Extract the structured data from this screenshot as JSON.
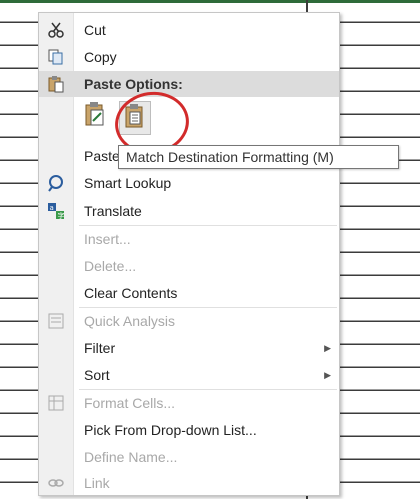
{
  "menu": {
    "items": [
      {
        "label": "Cut",
        "icon": "scissors-icon"
      },
      {
        "label": "Copy",
        "icon": "copy-icon"
      },
      {
        "label": "Paste Options:",
        "icon": "paste-icon"
      },
      {
        "label": "Paste Special...",
        "icon": ""
      },
      {
        "label": "Smart Lookup",
        "icon": "smart-lookup-icon"
      },
      {
        "label": "Translate",
        "icon": "translate-icon"
      },
      {
        "label": "Insert...",
        "icon": ""
      },
      {
        "label": "Delete...",
        "icon": ""
      },
      {
        "label": "Clear Contents",
        "icon": ""
      },
      {
        "label": "Quick Analysis",
        "icon": "quick-analysis-icon"
      },
      {
        "label": "Filter",
        "icon": ""
      },
      {
        "label": "Sort",
        "icon": ""
      },
      {
        "label": "Format Cells...",
        "icon": "format-cells-icon"
      },
      {
        "label": "Pick From Drop-down List...",
        "icon": ""
      },
      {
        "label": "Define Name...",
        "icon": ""
      },
      {
        "label": "Link",
        "icon": "link-icon"
      }
    ]
  },
  "tooltip": {
    "text": "Match Destination Formatting (M)"
  },
  "colors": {
    "highlight_circle": "#d22b2b",
    "header_bg": "#dcdcdc"
  }
}
